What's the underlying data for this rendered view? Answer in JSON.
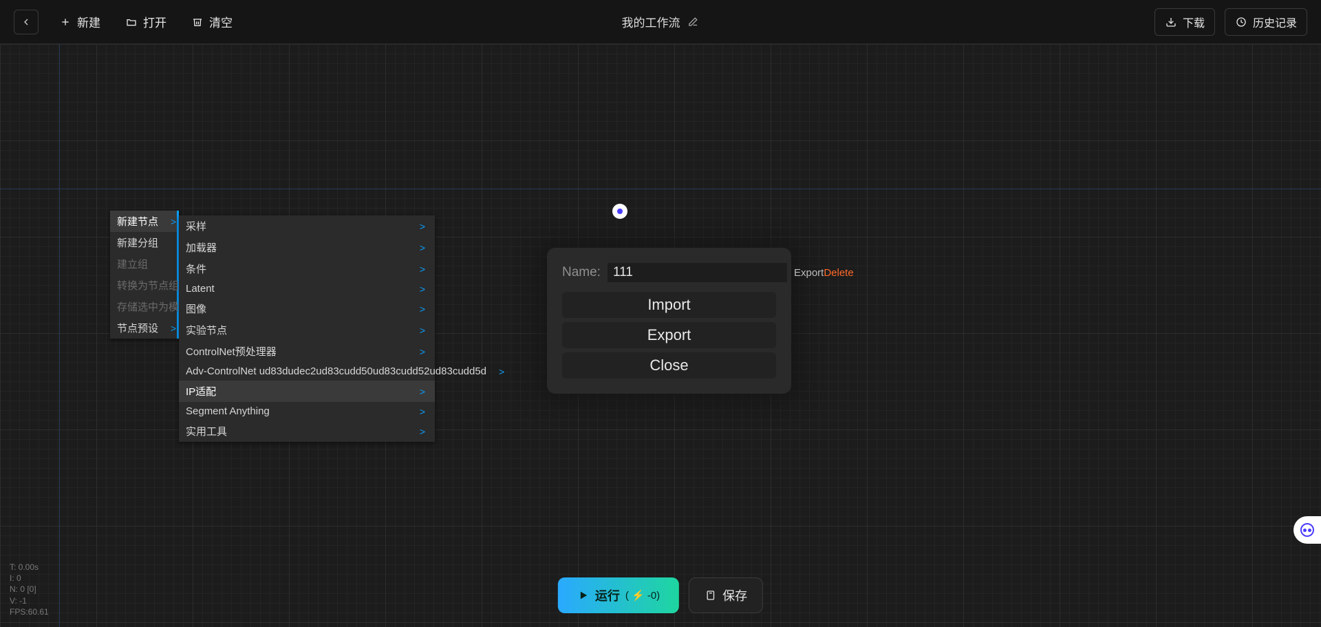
{
  "topbar": {
    "new": "新建",
    "open": "打开",
    "clear": "清空",
    "download": "下载",
    "history": "历史记录"
  },
  "workflow_title": "我的工作流",
  "context_menu": {
    "items": [
      {
        "label": "新建节点",
        "disabled": false,
        "sub": true,
        "selected": true
      },
      {
        "label": "新建分组",
        "disabled": false,
        "sub": false,
        "selected": false
      },
      {
        "label": "建立组",
        "disabled": true,
        "sub": false,
        "selected": false
      },
      {
        "label": "转换为节点组",
        "disabled": true,
        "sub": false,
        "selected": false
      },
      {
        "label": "存储选中为模板",
        "disabled": true,
        "sub": false,
        "selected": false
      },
      {
        "label": "节点预设",
        "disabled": false,
        "sub": true,
        "selected": false
      }
    ]
  },
  "sub_menu": {
    "items": [
      {
        "label": "采样",
        "selected": false
      },
      {
        "label": "加载器",
        "selected": false
      },
      {
        "label": "条件",
        "selected": false
      },
      {
        "label": "Latent",
        "selected": false
      },
      {
        "label": "图像",
        "selected": false
      },
      {
        "label": "实验节点",
        "selected": false
      },
      {
        "label": "ControlNet预处理器",
        "selected": false
      },
      {
        "label": "Adv-ControlNet ud83dudec2ud83cudd50ud83cudd52ud83cudd5d",
        "selected": false
      },
      {
        "label": "IP适配",
        "selected": true
      },
      {
        "label": "Segment Anything",
        "selected": false
      },
      {
        "label": "实用工具",
        "selected": false
      }
    ]
  },
  "dialog": {
    "name_label": "Name:",
    "name_value": "111",
    "export_link": "Export",
    "delete_link": "Delete",
    "import_btn": "Import",
    "export_btn": "Export",
    "close_btn": "Close"
  },
  "bottom": {
    "run": "运行",
    "cost": "( ⚡ -0)",
    "save": "保存"
  },
  "stats": {
    "t": "T: 0.00s",
    "i": "I: 0",
    "n": "N: 0 [0]",
    "v": "V: -1",
    "fps": "FPS:60.61"
  }
}
